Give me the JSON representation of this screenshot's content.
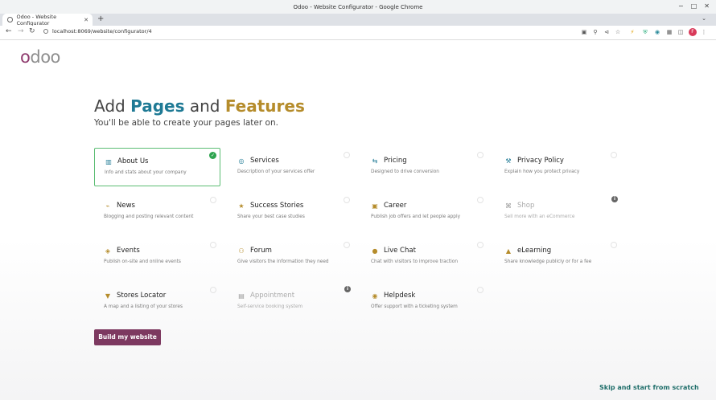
{
  "window": {
    "title": "Odoo - Website Configurator - Google Chrome"
  },
  "tab": {
    "label": "Odoo - Website Configurator"
  },
  "address_bar": {
    "url": "localhost:8069/website/configurator/4"
  },
  "profile_initial": "F",
  "logo": {
    "text": "odoo"
  },
  "heading": {
    "part1": "Add ",
    "pages": "Pages",
    "part2": " and ",
    "features": "Features"
  },
  "subheading": "You'll be able to create your pages later on.",
  "colors": {
    "accent_primary": "#7d3960",
    "pages_blue": "#1f7a95",
    "features_gold": "#b58c2b",
    "selected_green": "#5bbd73",
    "skip_teal": "#1f6e6a"
  },
  "features": [
    {
      "title": "About Us",
      "desc": "Info and stats about your company",
      "icon": "building-icon",
      "color": "#1f7a95",
      "state": "selected"
    },
    {
      "title": "Services",
      "desc": "Description of your services offer",
      "icon": "eye-icon",
      "color": "#1f7a95",
      "state": "off"
    },
    {
      "title": "Pricing",
      "desc": "Designed to drive conversion",
      "icon": "shuffle-icon",
      "color": "#1f7a95",
      "state": "off"
    },
    {
      "title": "Privacy Policy",
      "desc": "Explain how you protect privacy",
      "icon": "gavel-icon",
      "color": "#1f7a95",
      "state": "off"
    },
    {
      "title": "News",
      "desc": "Blogging and posting relevant content",
      "icon": "rss-icon",
      "color": "#b58c2b",
      "state": "off"
    },
    {
      "title": "Success Stories",
      "desc": "Share your best case studies",
      "icon": "star-icon",
      "color": "#b58c2b",
      "state": "off"
    },
    {
      "title": "Career",
      "desc": "Publish job offers and let people apply",
      "icon": "id-card-icon",
      "color": "#b58c2b",
      "state": "off"
    },
    {
      "title": "Shop",
      "desc": "Sell more with an eCommerce",
      "icon": "cart-icon",
      "color": "#999999",
      "state": "disabled"
    },
    {
      "title": "Events",
      "desc": "Publish on-site and online events",
      "icon": "ticket-icon",
      "color": "#b58c2b",
      "state": "off"
    },
    {
      "title": "Forum",
      "desc": "Give visitors the information they need",
      "icon": "users-icon",
      "color": "#b58c2b",
      "state": "off"
    },
    {
      "title": "Live Chat",
      "desc": "Chat with visitors to improve traction",
      "icon": "comments-icon",
      "color": "#b58c2b",
      "state": "off"
    },
    {
      "title": "eLearning",
      "desc": "Share knowledge publicly or for a fee",
      "icon": "graduation-cap-icon",
      "color": "#b58c2b",
      "state": "off"
    },
    {
      "title": "Stores Locator",
      "desc": "A map and a listing of your stores",
      "icon": "map-marker-icon",
      "color": "#b58c2b",
      "state": "off"
    },
    {
      "title": "Appointment",
      "desc": "Self-service booking system",
      "icon": "calendar-icon",
      "color": "#999999",
      "state": "disabled"
    },
    {
      "title": "Helpdesk",
      "desc": "Offer support with a ticketing system",
      "icon": "life-ring-icon",
      "color": "#b58c2b",
      "state": "off"
    }
  ],
  "buttons": {
    "build": "Build my website",
    "skip": "Skip and start from scratch"
  }
}
